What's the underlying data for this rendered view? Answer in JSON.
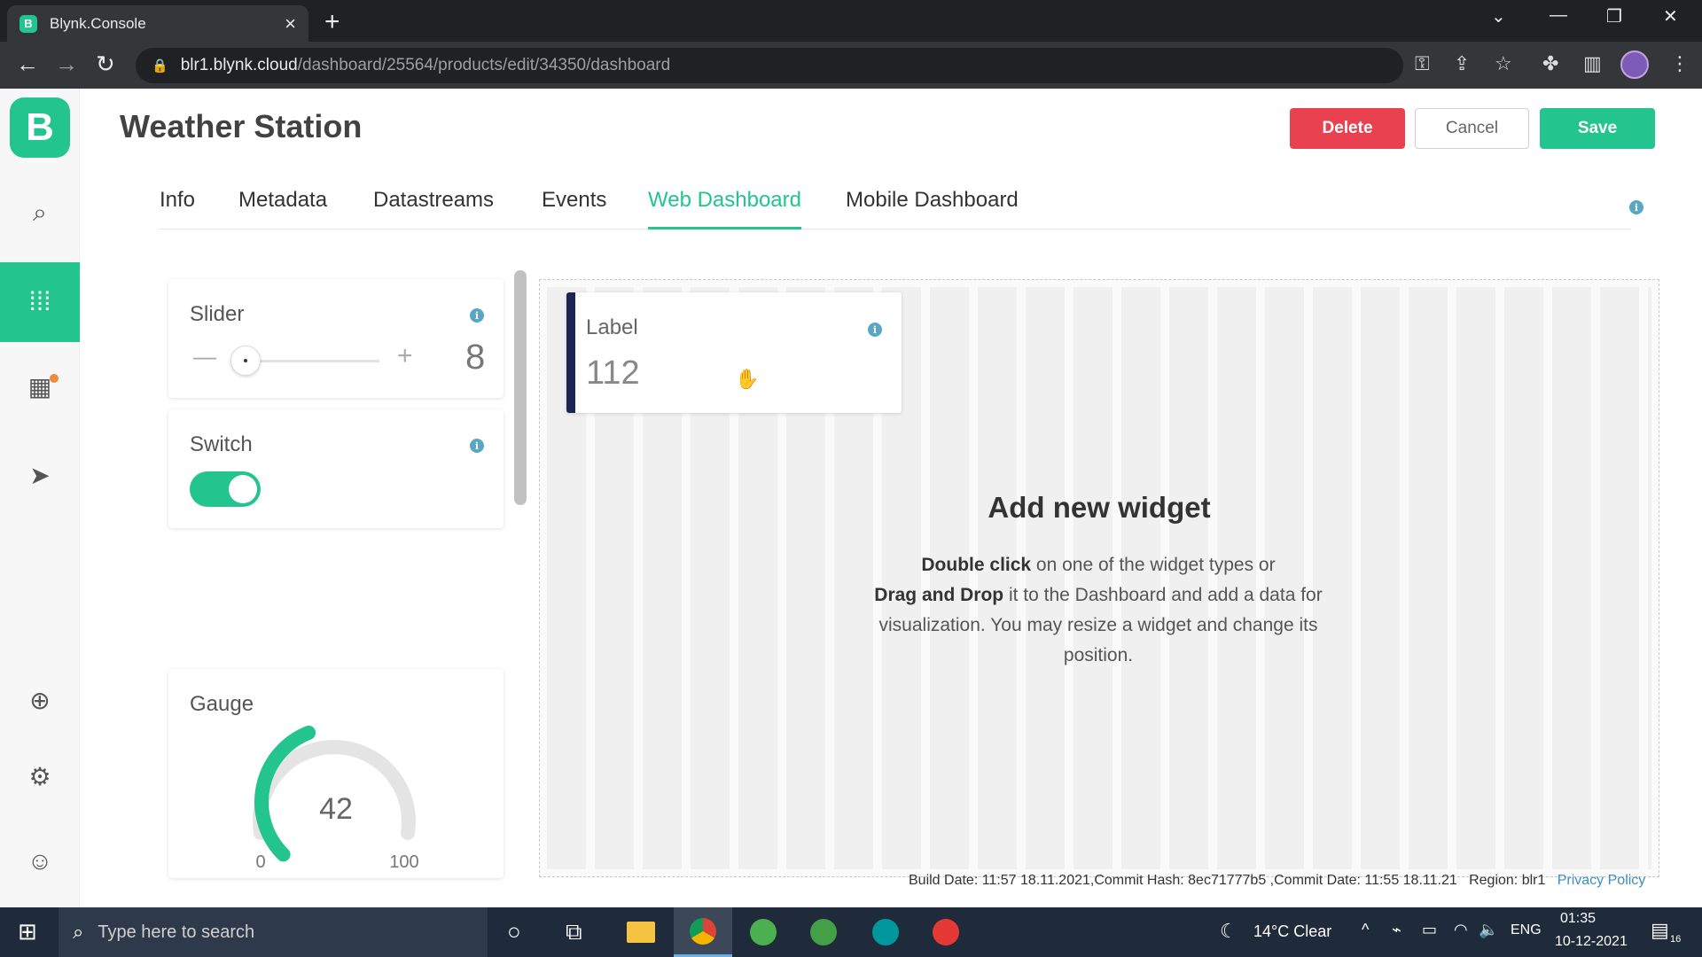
{
  "browser": {
    "tab_title": "Blynk.Console",
    "tab_favicon": "B",
    "url_host": "blr1.blynk.cloud",
    "url_path": "/dashboard/25564/products/edit/34350/dashboard"
  },
  "sidebar": {
    "logo": "B"
  },
  "page": {
    "title": "Weather Station",
    "delete_label": "Delete",
    "cancel_label": "Cancel",
    "save_label": "Save"
  },
  "tabs": [
    {
      "label": "Info"
    },
    {
      "label": "Metadata"
    },
    {
      "label": "Datastreams"
    },
    {
      "label": "Events"
    },
    {
      "label": "Web Dashboard"
    },
    {
      "label": "Mobile Dashboard"
    }
  ],
  "widgets": {
    "slider": {
      "title": "Slider",
      "minus": "—",
      "plus": "+",
      "value": "8"
    },
    "switch": {
      "title": "Switch",
      "on": true
    },
    "gauge": {
      "title": "Gauge",
      "value": "42",
      "min": "0",
      "max": "100",
      "level": 0.42
    }
  },
  "dashboard": {
    "label_widget": {
      "title": "Label",
      "value": "112"
    },
    "add_title": "Add new widget",
    "add_bold1": "Double click",
    "add_text1": " on one of the widget types or",
    "add_bold2": "Drag and Drop",
    "add_text2": " it to the Dashboard and add a data for visualization. You may resize a widget and change its position."
  },
  "footer": {
    "build": "Build Date: 11:57 18.11.2021,Commit Hash: 8ec71777b5 ,Commit Date: 11:55 18.11.21",
    "region": "Region: blr1",
    "privacy": "Privacy Policy"
  },
  "taskbar": {
    "search_placeholder": "Type here to search",
    "weather": "14°C  Clear",
    "lang": "ENG",
    "time": "01:35",
    "date": "10-12-2021",
    "notif_count": "16"
  },
  "colors": {
    "accent": "#23c48e",
    "delete": "#e9414f",
    "label_bar": "#1d2554"
  }
}
